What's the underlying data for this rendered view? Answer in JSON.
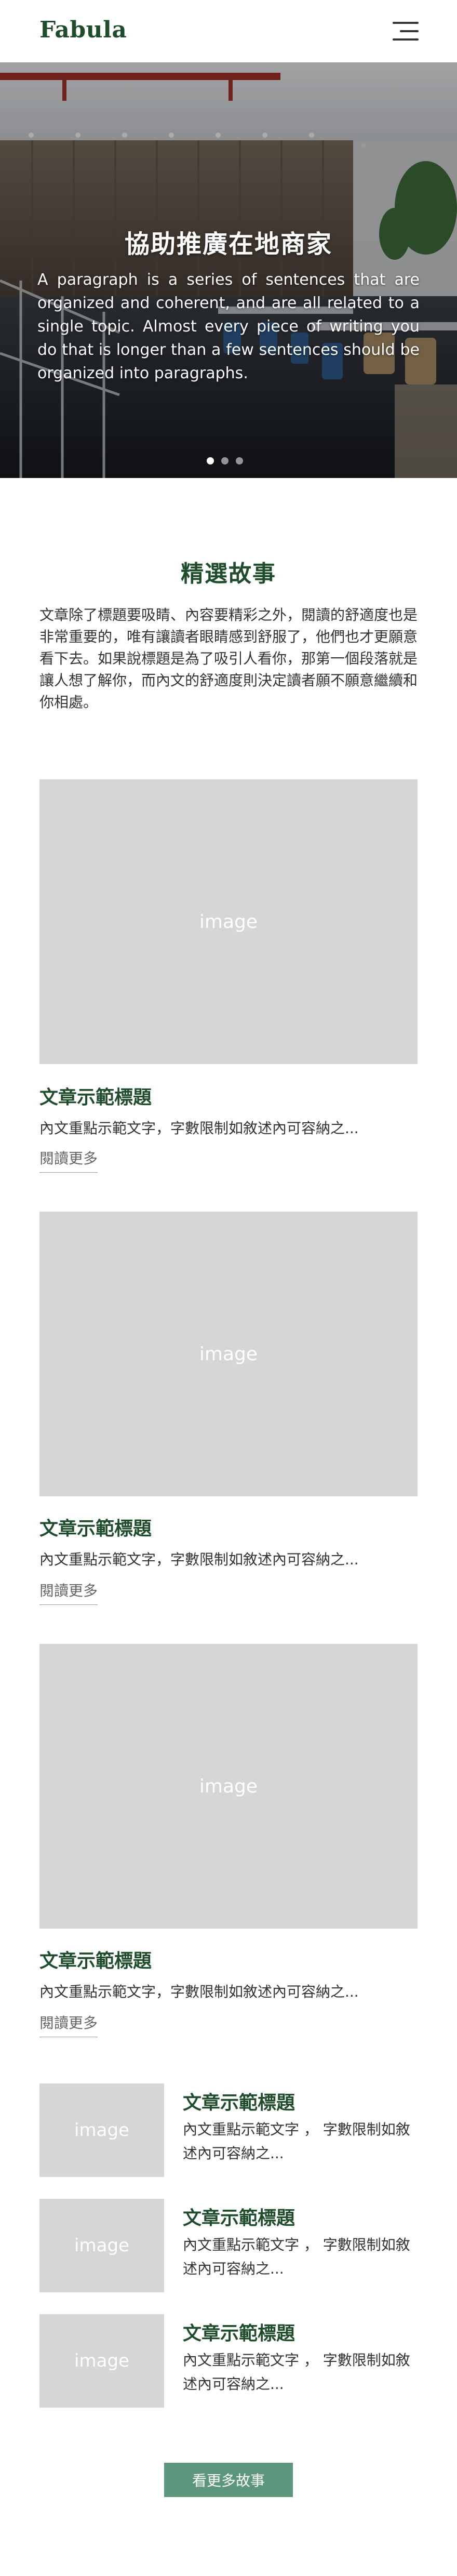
{
  "header": {
    "logo": "Fabula",
    "menu_icon": "hamburger-menu-icon"
  },
  "hero": {
    "title": "協助推廣在地商家",
    "description": "A paragraph is a series of sentences that are organized and coherent, and are all related to a single topic. Almost every piece of writing you do that is longer than a few sentences should be organized into paragraphs.",
    "slides": 3,
    "active_slide": 1
  },
  "featured": {
    "title": "精選故事",
    "intro": "文章除了標題要吸睛、內容要精彩之外，閱讀的舒適度也是非常重要的，唯有讓讀者眼睛感到舒服了，他們也才更願意看下去。如果說標題是為了吸引人看你，那第一個段落就是讓人想了解你，而內文的舒適度則決定讀者願不願意繼續和你相處。",
    "cards": [
      {
        "image_label": "image",
        "title": "文章示範標題",
        "excerpt": "內文重點示範文字，字數限制如敘述內可容納之...",
        "read_more": "閱讀更多"
      },
      {
        "image_label": "image",
        "title": "文章示範標題",
        "excerpt": "內文重點示範文字，字數限制如敘述內可容納之...",
        "read_more": "閱讀更多"
      },
      {
        "image_label": "image",
        "title": "文章示範標題",
        "excerpt": "內文重點示範文字，字數限制如敘述內可容納之...",
        "read_more": "閱讀更多"
      }
    ],
    "small_cards": [
      {
        "image_label": "image",
        "title": "文章示範標題",
        "excerpt": "內文重點示範文字 ， 字數限制如敘述內可容納之..."
      },
      {
        "image_label": "image",
        "title": "文章示範標題",
        "excerpt": "內文重點示範文字 ， 字數限制如敘述內可容納之..."
      },
      {
        "image_label": "image",
        "title": "文章示範標題",
        "excerpt": "內文重點示範文字 ， 字數限制如敘述內可容納之..."
      }
    ],
    "more_button": "看更多故事"
  },
  "colors": {
    "brand_green": "#1f4d2c",
    "button_green": "#5c977d",
    "placeholder_gray": "#d6d6d6"
  }
}
